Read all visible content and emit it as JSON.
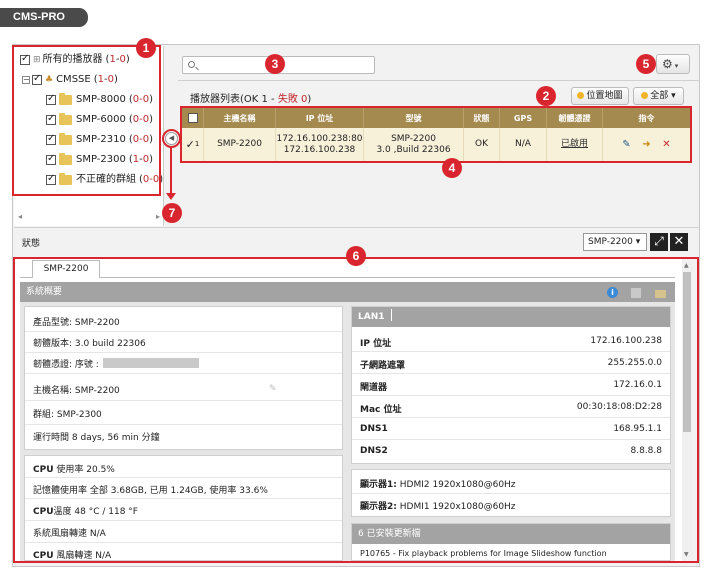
{
  "brand": {
    "title": "CMS-PRO"
  },
  "tree": {
    "root": {
      "label": "所有的播放器",
      "count_open": "(",
      "count_a": "1",
      "count_sep": "-",
      "count_b": "0",
      "count_close": ")"
    },
    "group": {
      "label": "CMSSE",
      "count_open": "(",
      "count_a": "1",
      "count_sep": "-",
      "count_b": "0",
      "count_close": ")"
    },
    "items": [
      {
        "label": "SMP-8000",
        "count_open": "(",
        "count_a": "0",
        "count_sep": "-",
        "count_b": "0",
        "count_close": ")"
      },
      {
        "label": "SMP-6000",
        "count_open": "(",
        "count_a": "0",
        "count_sep": "-",
        "count_b": "0",
        "count_close": ")"
      },
      {
        "label": "SMP-2310",
        "count_open": "(",
        "count_a": "0",
        "count_sep": "-",
        "count_b": "0",
        "count_close": ")"
      },
      {
        "label": "SMP-2300",
        "count_open": "(",
        "count_a": "1",
        "count_sep": "-",
        "count_b": "0",
        "count_close": ")"
      },
      {
        "label": "不正確的群組",
        "count_open": "(",
        "count_a": "0",
        "count_sep": "-",
        "count_b": "0",
        "count_close": ")"
      }
    ]
  },
  "badges": [
    "1",
    "2",
    "3",
    "4",
    "5",
    "6",
    "7"
  ],
  "toolbar": {
    "gear_icon": "⚙",
    "caret": "▾"
  },
  "list": {
    "title_prefix": "播放器列表(OK 1 - ",
    "title_fail": "失敗 0",
    "title_suffix": ")",
    "map_button": "位置地圖",
    "all_button": "全部",
    "columns": [
      "",
      "主機名稱",
      "IP 位址",
      "型號",
      "狀態",
      "GPS",
      "韌體憑證",
      "指令"
    ],
    "row": {
      "check": "✓",
      "index": "1",
      "hostname": "SMP-2200",
      "ip_line1": "172.16.100.238:80",
      "ip_line2": "172.16.100.238",
      "model_line1": "SMP-2200",
      "model_line2": "3.0 ,Build 22306",
      "status": "OK",
      "gps": "N/A",
      "cert": "已啟用"
    }
  },
  "status_bar": {
    "label": "狀態",
    "selected_device": "SMP-2200",
    "select_caret": "▾",
    "expand_icon": "⤢",
    "close_icon": "✕"
  },
  "detail": {
    "tab": "SMP-2200",
    "section_title": "系統概要",
    "info_icon": "i",
    "device_info": [
      {
        "label": "產品型號:",
        "value": "SMP-2200"
      },
      {
        "label": "韌體版本:",
        "value": "3.0 build 22306"
      },
      {
        "label": "韌體憑證:",
        "value": "序號 :"
      },
      {
        "label": "主機名稱:",
        "value": "SMP-2200"
      },
      {
        "label": "群組:",
        "value": "SMP-2300"
      },
      {
        "label": "運行時間",
        "value": "8 days, 56 min 分鐘"
      }
    ],
    "hw_info": [
      {
        "label": "CPU",
        "label2": "使用率",
        "value": "使用率 20.5%"
      },
      {
        "label": "記憶體使用率",
        "label2": "",
        "value": "全部 3.68GB, 已用 1.24GB, 使用率 33.6%"
      },
      {
        "label": "CPU",
        "label2": "溫度",
        "value": "48 °C / 118 °F"
      },
      {
        "label": "系統風扇轉速",
        "label2": "",
        "value": "N/A"
      },
      {
        "label": "CPU",
        "label2": "風扇轉速",
        "value": "N/A"
      }
    ],
    "lan": {
      "title": "LAN1",
      "rows": [
        {
          "label": "IP 位址",
          "value": "172.16.100.238"
        },
        {
          "label": "子網路遮罩",
          "value": "255.255.0.0"
        },
        {
          "label": "閘道器",
          "value": "172.16.0.1"
        },
        {
          "label": "Mac 位址",
          "value": "00:30:18:08:D2:28"
        },
        {
          "label": "DNS1",
          "value": "168.95.1.1"
        },
        {
          "label": "DNS2",
          "value": "8.8.8.8"
        }
      ]
    },
    "displays": [
      {
        "label": "顯示器1:",
        "value": "HDMI2 1920x1080@60Hz"
      },
      {
        "label": "顯示器2:",
        "value": "HDMI1 1920x1080@60Hz"
      }
    ],
    "updates": {
      "title": "6 已安裝更新檔",
      "first_item": "P10765 - Fix playback problems for Image Slideshow function"
    }
  }
}
